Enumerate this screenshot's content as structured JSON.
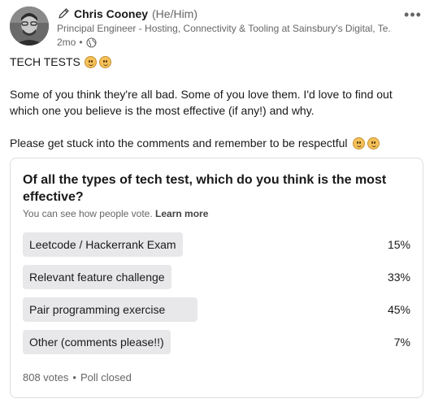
{
  "author": {
    "name": "Chris Cooney",
    "pronouns": "(He/Him)",
    "headline": "Principal Engineer - Hosting, Connectivity & Tooling at Sainsbury's Digital, Te...",
    "time": "2mo",
    "meta_sep": "•",
    "icons": {
      "creator": "pencil-icon",
      "visibility": "globe-icon",
      "menu": "more-horizontal-icon"
    }
  },
  "menu": {
    "label": "•••"
  },
  "post": {
    "title": "TECH TESTS",
    "paragraph1": "Some of you think they're all bad. Some of you love them. I'd love to find out which one you believe is the most effective (if any!) and why.",
    "paragraph2": "Please get stuck into the comments and remember to be respectful"
  },
  "poll": {
    "question": "Of all the types of tech test, which do you think is the most effective?",
    "hint": "You can see how people vote.",
    "learn_more": "Learn more",
    "options": [
      {
        "label": "Leetcode / Hackerrank Exam",
        "percent": "15%",
        "fraction": 0.15
      },
      {
        "label": "Relevant feature challenge",
        "percent": "33%",
        "fraction": 0.33
      },
      {
        "label": "Pair programming exercise",
        "percent": "45%",
        "fraction": 0.45
      },
      {
        "label": "Other (comments please!!)",
        "percent": "7%",
        "fraction": 0.07
      }
    ],
    "votes": "808 votes",
    "separator": "•",
    "status": "Poll closed"
  },
  "colors": {
    "bar": "#e8e8ea",
    "text": "#191919",
    "muted": "#666666",
    "border": "#dddddd"
  }
}
